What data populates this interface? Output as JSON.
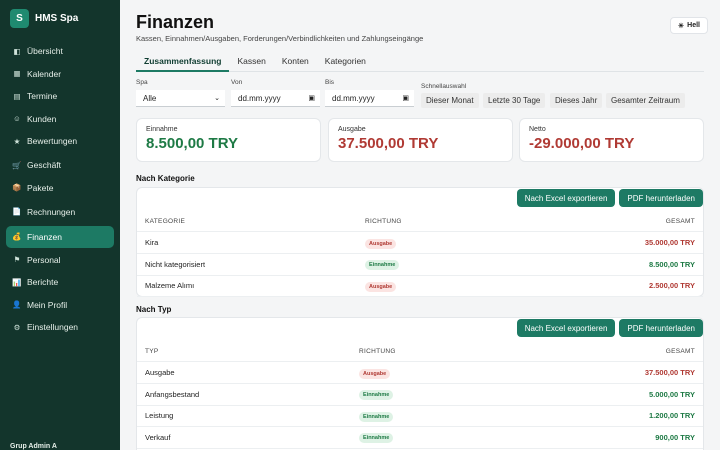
{
  "brand": {
    "logo_letter": "S",
    "name": "HMS Spa"
  },
  "sidebar": {
    "items": [
      {
        "icon": "◧",
        "icon_name": "overview-icon",
        "label": "Übersicht"
      },
      {
        "icon": "▦",
        "icon_name": "calendar-icon",
        "label": "Kalender"
      },
      {
        "icon": "▤",
        "icon_name": "appointments-icon",
        "label": "Termine"
      },
      {
        "icon": "☺",
        "icon_name": "customers-icon",
        "label": "Kunden"
      },
      {
        "icon": "★",
        "icon_name": "star-icon",
        "label": "Bewertungen"
      },
      {
        "icon": "🛒",
        "icon_name": "cart-icon",
        "label": "Geschäft"
      },
      {
        "icon": "📦",
        "icon_name": "package-icon",
        "label": "Pakete"
      },
      {
        "icon": "📄",
        "icon_name": "invoice-icon",
        "label": "Rechnungen"
      },
      {
        "icon": "💰",
        "icon_name": "money-bag-icon",
        "label": "Finanzen"
      },
      {
        "icon": "⚑",
        "icon_name": "flag-icon",
        "label": "Personal"
      },
      {
        "icon": "📊",
        "icon_name": "chart-icon",
        "label": "Berichte"
      },
      {
        "icon": "👤",
        "icon_name": "user-icon",
        "label": "Mein Profil"
      },
      {
        "icon": "⚙",
        "icon_name": "gear-icon",
        "label": "Einstellungen"
      }
    ],
    "active_index": 8,
    "user": "Grup Admin A"
  },
  "page": {
    "title": "Finanzen",
    "subtitle": "Kassen, Einnahmen/Ausgaben, Forderungen/Verbindlichkeiten und Zahlungseingänge",
    "theme_icon": "☀",
    "theme_label": "Hell"
  },
  "tabs": [
    "Zusammenfassung",
    "Kassen",
    "Konten",
    "Kategorien"
  ],
  "filters": {
    "spa_label": "Spa",
    "spa_value": "Alle",
    "von_label": "Von",
    "von_value": "dd.mm.yyyy",
    "bis_label": "Bis",
    "bis_value": "dd.mm.yyyy",
    "quick_label": "Schnellauswahl",
    "quick": [
      "Dieser Monat",
      "Letzte 30 Tage",
      "Dieses Jahr",
      "Gesamter Zeitraum"
    ]
  },
  "summary": {
    "income_label": "Einnahme",
    "income_value": "8.500,00 TRY",
    "expense_label": "Ausgabe",
    "expense_value": "37.500,00 TRY",
    "net_label": "Netto",
    "net_value": "-29.000,00 TRY"
  },
  "export_label": "Nach Excel exportieren",
  "pdf_label": "PDF herunterladen",
  "by_category": {
    "title": "Nach Kategorie",
    "headers": [
      "KATEGORIE",
      "RICHTUNG",
      "GESAMT"
    ],
    "rows": [
      {
        "name": "Kira",
        "direction": "Ausgabe",
        "type": "out",
        "total": "35.000,00 TRY"
      },
      {
        "name": "Nicht kategorisiert",
        "direction": "Einnahme",
        "type": "in",
        "total": "8.500,00 TRY"
      },
      {
        "name": "Malzeme Alımı",
        "direction": "Ausgabe",
        "type": "out",
        "total": "2.500,00 TRY"
      }
    ]
  },
  "by_type": {
    "title": "Nach Typ",
    "headers": [
      "TYP",
      "RICHTUNG",
      "GESAMT"
    ],
    "rows": [
      {
        "name": "Ausgabe",
        "direction": "Ausgabe",
        "type": "out",
        "total": "37.500,00 TRY"
      },
      {
        "name": "Anfangsbestand",
        "direction": "Einnahme",
        "type": "in",
        "total": "5.000,00 TRY"
      },
      {
        "name": "Leistung",
        "direction": "Einnahme",
        "type": "in",
        "total": "1.200,00 TRY"
      },
      {
        "name": "Verkauf",
        "direction": "Einnahme",
        "type": "in",
        "total": "900,00 TRY"
      }
    ]
  },
  "colors": {
    "sidebar_bg": "#13352c",
    "accent": "#1d7a64",
    "positive": "#1e7a45",
    "negative": "#b03a34"
  }
}
